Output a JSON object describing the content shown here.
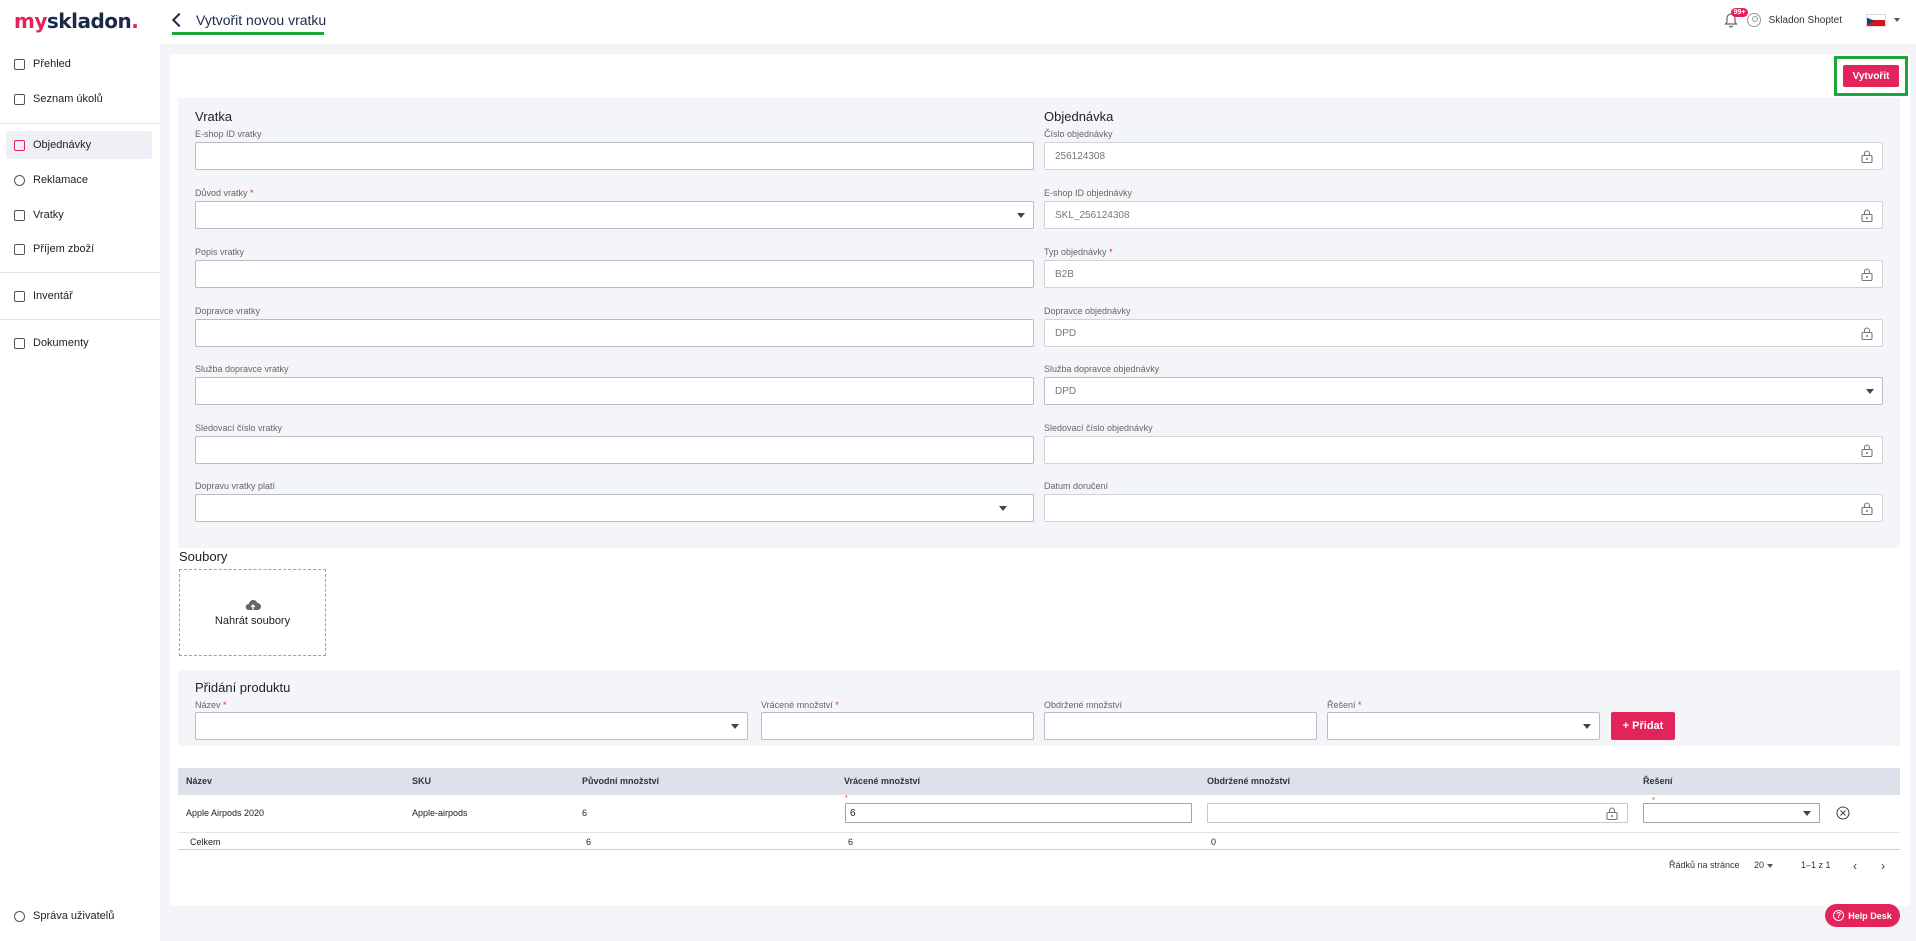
{
  "brand": {
    "my": "my",
    "rest": "skladon",
    "dot": "."
  },
  "page": {
    "title": "Vytvořit novou vratku"
  },
  "header": {
    "notif_count": "99+",
    "user": "Skladon Shoptet"
  },
  "sidebar": {
    "items": [
      {
        "label": "Přehled",
        "icon": "dashboard-icon"
      },
      {
        "label": "Seznam úkolů",
        "icon": "task-list-icon"
      },
      {
        "label": "Objednávky",
        "icon": "box-icon",
        "active": true
      },
      {
        "label": "Reklamace",
        "icon": "complaint-icon"
      },
      {
        "label": "Vratky",
        "icon": "return-icon"
      },
      {
        "label": "Příjem zboží",
        "icon": "inbox-icon"
      },
      {
        "label": "Inventář",
        "icon": "mail-icon"
      },
      {
        "label": "Dokumenty",
        "icon": "document-icon"
      }
    ],
    "bottom": "Správa uživatelů"
  },
  "actions": {
    "create": "Vytvořit"
  },
  "vratka": {
    "title": "Vratka",
    "fields": [
      {
        "label": "E-shop ID vratky",
        "value": ""
      },
      {
        "label": "Důvod vratky",
        "required": "*",
        "value": ""
      },
      {
        "label": "Popis vratky",
        "value": ""
      },
      {
        "label": "Dopravce vratky",
        "value": ""
      },
      {
        "label": "Služba dopravce vratky",
        "value": ""
      },
      {
        "label": "Sledovací číslo vratky",
        "value": ""
      },
      {
        "label": "Dopravu vratky platí",
        "value": ""
      }
    ]
  },
  "objednavka": {
    "title": "Objednávka",
    "fields": [
      {
        "label": "Číslo objednávky",
        "value": "256124308"
      },
      {
        "label": "E-shop ID objednávky",
        "value": "SKL_256124308"
      },
      {
        "label": "Typ objednávky",
        "required": "*",
        "value": "B2B"
      },
      {
        "label": "Dopravce objednávky",
        "value": "DPD"
      },
      {
        "label": "Služba dopravce objednávky",
        "value": "DPD"
      },
      {
        "label": "Sledovací číslo objednávky",
        "value": ""
      },
      {
        "label": "Datum doručení",
        "value": ""
      }
    ]
  },
  "files": {
    "title": "Soubory",
    "upload": "Nahrát soubory"
  },
  "add_product": {
    "title": "Přidání produktu",
    "name_label": "Název",
    "returned_label": "Vrácené množství",
    "received_label": "Obdržené množství",
    "resolution_label": "Řešení",
    "req": "*",
    "add_button": "+ Přidat"
  },
  "table": {
    "columns": [
      "Název",
      "SKU",
      "Původní množství",
      "Vrácené množství",
      "Obdržené množství",
      "Řešení"
    ],
    "rows": [
      {
        "name": "Apple Airpods 2020",
        "sku": "Apple-airpods",
        "original": "6",
        "returned": "6",
        "received": "",
        "resolution": ""
      }
    ],
    "total": {
      "label": "Celkem",
      "original": "6",
      "returned": "6",
      "received": "0"
    }
  },
  "pagination": {
    "rows_label": "Řádků na stránce",
    "rows_per_page": "20",
    "range": "1–1 z 1"
  },
  "helpdesk": "Help Desk"
}
